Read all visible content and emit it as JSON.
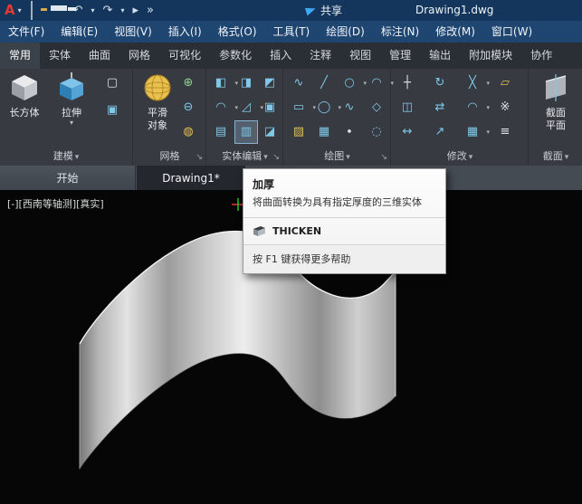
{
  "window": {
    "logo": "A",
    "title": "Drawing1.dwg",
    "share_label": "共享"
  },
  "menu": {
    "items": [
      "文件(F)",
      "编辑(E)",
      "视图(V)",
      "插入(I)",
      "格式(O)",
      "工具(T)",
      "绘图(D)",
      "标注(N)",
      "修改(M)",
      "窗口(W)"
    ]
  },
  "ribbon": {
    "tabs": [
      "常用",
      "实体",
      "曲面",
      "网格",
      "可视化",
      "参数化",
      "插入",
      "注释",
      "视图",
      "管理",
      "输出",
      "附加模块",
      "协作"
    ],
    "panels": {
      "modeling": {
        "label": "建模",
        "box": "长方体",
        "extrude": "拉伸"
      },
      "mesh": {
        "label": "网格",
        "smooth_line1": "平滑",
        "smooth_line2": "对象"
      },
      "solid_editing": {
        "label": "实体编辑"
      },
      "draw": {
        "label": "绘图"
      },
      "modify": {
        "label": "修改"
      },
      "section": {
        "label": "截面",
        "plane_line1": "截面",
        "plane_line2": "平面"
      }
    }
  },
  "file_tabs": {
    "start": "开始",
    "drawing": "Drawing1*"
  },
  "viewport": {
    "controls": "[-][西南等轴测][真实]"
  },
  "tooltip": {
    "title": "加厚",
    "description": "将曲面转换为具有指定厚度的三维实体",
    "command": "THICKEN",
    "help": "按 F1 键获得更多帮助"
  },
  "glyphs": {
    "caret": "▾",
    "undo": "↶",
    "redo": "↷",
    "play": "▸",
    "forward": "»",
    "launcher": "↘",
    "union": "◧",
    "subtract": "◨",
    "intersect": "◩",
    "extrude_face": "◠",
    "move_face": "◿",
    "shell": "▣",
    "imprint": "▤",
    "thicken": "▥",
    "separate": "◪",
    "polyline": "∿",
    "line": "╱",
    "circle": "○",
    "arc": "◠",
    "rect": "▭",
    "ellipse": "◯",
    "spline": "∿",
    "polygon": "◇",
    "hatch": "▨",
    "region": "▦",
    "point": "∙",
    "cloud": "◌",
    "move": "┼",
    "rotate": "↻",
    "trim": "╳",
    "erase": "▱",
    "copy": "◫",
    "mirror": "⇄",
    "fillet": "◠",
    "explode": "※",
    "stretch": "↔",
    "scale": "↗",
    "array": "▦",
    "offset": "≡",
    "polysolid": "▢",
    "presspull": "▣",
    "smooth_more": "⊕",
    "smooth_less": "⊖",
    "refine": "◍"
  }
}
